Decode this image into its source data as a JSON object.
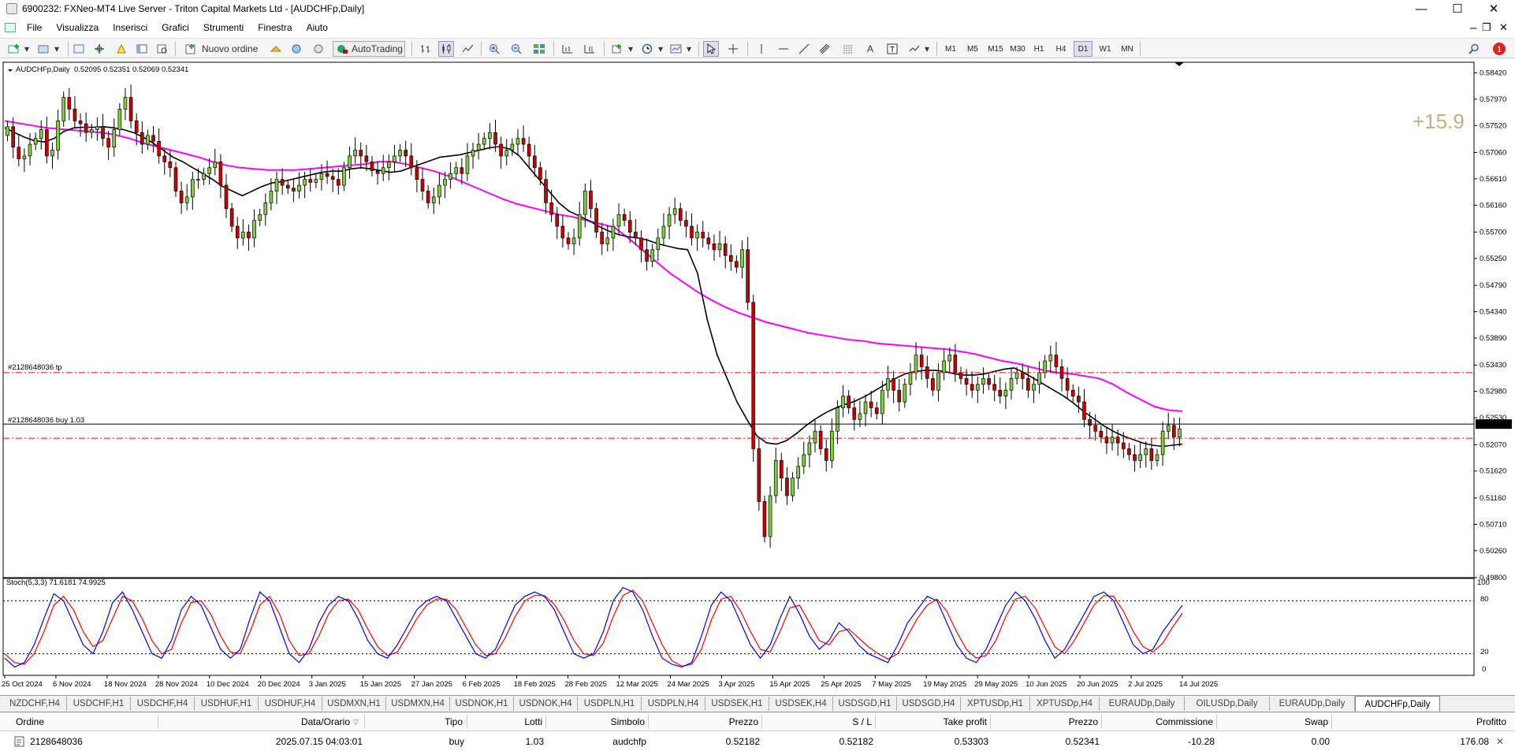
{
  "window": {
    "title": "6900232: FXNeo-MT4 Live Server - Triton Capital Markets Ltd - [AUDCHFp,Daily]",
    "min": "—",
    "max": "☐",
    "close": "✕"
  },
  "menu": [
    "File",
    "Visualizza",
    "Inserisci",
    "Grafici",
    "Strumenti",
    "Finestra",
    "Aiuto"
  ],
  "toolbar": {
    "new_order": "Nuovo ordine",
    "autotrading": "AutoTrading",
    "timeframes": [
      "M1",
      "M5",
      "M15",
      "M30",
      "H1",
      "H4",
      "D1",
      "W1",
      "MN"
    ],
    "active_timeframe": "D1",
    "tool_icons": [
      "cursor-icon",
      "crosshair-icon",
      "vertical-line-icon",
      "horizontal-line-icon",
      "trendline-icon",
      "channel-icon",
      "fibonacci-icon",
      "text-icon",
      "label-icon",
      "shapes-icon"
    ],
    "notification_count": "1"
  },
  "chart": {
    "symbol_label": "AUDCHFp,Daily",
    "ohlc": "0.52095 0.52351 0.52069 0.52341",
    "profit_overlay": "+15.9",
    "tp_line_label": "#2128648036 tp",
    "buy_line_label": "#2128648036 buy 1.03",
    "current_price": "0.52341",
    "price_ticks": [
      "0.58420",
      "0.57970",
      "0.57520",
      "0.57060",
      "0.56610",
      "0.56160",
      "0.55700",
      "0.55250",
      "0.54790",
      "0.54340",
      "0.53890",
      "0.53430",
      "0.52980",
      "0.52530",
      "0.52070",
      "0.51620",
      "0.51160",
      "0.50710",
      "0.50260",
      "0.49800"
    ],
    "date_ticks": [
      "25 Oct 2024",
      "6 Nov 2024",
      "18 Nov 2024",
      "28 Nov 2024",
      "10 Dec 2024",
      "20 Dec 2024",
      "3 Jan 2025",
      "15 Jan 2025",
      "27 Jan 2025",
      "6 Feb 2025",
      "18 Feb 2025",
      "28 Feb 2025",
      "12 Mar 2025",
      "24 Mar 2025",
      "3 Apr 2025",
      "15 Apr 2025",
      "25 Apr 2025",
      "7 May 2025",
      "19 May 2025",
      "29 May 2025",
      "10 Jun 2025",
      "20 Jun 2025",
      "2 Jul 2025",
      "14 Jul 2025"
    ],
    "colors": {
      "bull": "#7cd13a",
      "bear": "#cc0000",
      "ma_fast": "#000000",
      "ma_slow": "#ff00ff",
      "trade_line": "#ff0000",
      "stoch_main": "#0000ff",
      "stoch_signal": "#ff0000"
    },
    "stoch": {
      "label": "Stoch(5,3,3) 71.6181 74.9925",
      "levels": [
        "100",
        "80",
        "20",
        "0"
      ]
    }
  },
  "chart_data": [
    {
      "type": "candlestick",
      "symbol": "AUDCHFp",
      "timeframe": "Daily",
      "ylim": [
        0.498,
        0.586
      ],
      "tp": 0.533,
      "entry": 0.5218,
      "last": 0.52341,
      "close": [
        0.575,
        0.5715,
        0.5695,
        0.57,
        0.572,
        0.573,
        0.5745,
        0.57,
        0.571,
        0.576,
        0.58,
        0.578,
        0.576,
        0.5755,
        0.574,
        0.5745,
        0.575,
        0.573,
        0.5715,
        0.5745,
        0.578,
        0.58,
        0.576,
        0.574,
        0.572,
        0.5735,
        0.5725,
        0.57,
        0.569,
        0.568,
        0.564,
        0.562,
        0.563,
        0.566,
        0.566,
        0.567,
        0.568,
        0.569,
        0.565,
        0.561,
        0.558,
        0.556,
        0.557,
        0.556,
        0.559,
        0.56,
        0.562,
        0.564,
        0.566,
        0.565,
        0.5645,
        0.564,
        0.565,
        0.566,
        0.5655,
        0.566,
        0.567,
        0.5665,
        0.566,
        0.565,
        0.568,
        0.57,
        0.571,
        0.57,
        0.569,
        0.5675,
        0.567,
        0.568,
        0.569,
        0.57,
        0.571,
        0.57,
        0.568,
        0.566,
        0.564,
        0.562,
        0.563,
        0.565,
        0.566,
        0.567,
        0.568,
        0.567,
        0.57,
        0.571,
        0.572,
        0.573,
        0.574,
        0.572,
        0.57,
        0.571,
        0.572,
        0.573,
        0.572,
        0.57,
        0.568,
        0.566,
        0.562,
        0.56,
        0.558,
        0.556,
        0.555,
        0.556,
        0.56,
        0.564,
        0.561,
        0.557,
        0.555,
        0.556,
        0.558,
        0.56,
        0.559,
        0.557,
        0.556,
        0.554,
        0.552,
        0.554,
        0.556,
        0.558,
        0.56,
        0.561,
        0.559,
        0.558,
        0.556,
        0.557,
        0.556,
        0.555,
        0.554,
        0.555,
        0.553,
        0.552,
        0.551,
        0.554,
        0.545,
        0.52,
        0.511,
        0.505,
        0.512,
        0.518,
        0.515,
        0.512,
        0.515,
        0.517,
        0.519,
        0.521,
        0.523,
        0.52,
        0.518,
        0.523,
        0.527,
        0.529,
        0.527,
        0.525,
        0.526,
        0.528,
        0.527,
        0.526,
        0.53,
        0.532,
        0.53,
        0.528,
        0.531,
        0.533,
        0.536,
        0.534,
        0.532,
        0.53,
        0.533,
        0.535,
        0.536,
        0.533,
        0.532,
        0.531,
        0.53,
        0.531,
        0.532,
        0.531,
        0.53,
        0.529,
        0.53,
        0.532,
        0.533,
        0.532,
        0.53,
        0.531,
        0.533,
        0.535,
        0.536,
        0.534,
        0.532,
        0.53,
        0.529,
        0.528,
        0.525,
        0.524,
        0.523,
        0.522,
        0.521,
        0.522,
        0.521,
        0.52,
        0.519,
        0.518,
        0.519,
        0.52,
        0.518,
        0.519,
        0.523,
        0.524,
        0.522,
        0.52341
      ],
      "ma_fast": [
        0.5748,
        0.574,
        0.5732,
        0.5726,
        0.5724,
        0.573,
        0.5742,
        0.5748,
        0.5749,
        0.5749,
        0.575,
        0.5748,
        0.5745,
        0.574,
        0.5732,
        0.5722,
        0.571,
        0.5698,
        0.569,
        0.568,
        0.567,
        0.566,
        0.5648,
        0.564,
        0.5632,
        0.564,
        0.5648,
        0.5654,
        0.5656,
        0.566,
        0.5664,
        0.5668,
        0.5672,
        0.5674,
        0.5674,
        0.5678,
        0.568,
        0.5678,
        0.5675,
        0.5672,
        0.5674,
        0.568,
        0.5686,
        0.5692,
        0.5698,
        0.57,
        0.5702,
        0.5706,
        0.571,
        0.5714,
        0.5716,
        0.5712,
        0.57,
        0.568,
        0.566,
        0.564,
        0.562,
        0.5606,
        0.5598,
        0.559,
        0.558,
        0.5572,
        0.5566,
        0.5562,
        0.556,
        0.5556,
        0.555,
        0.5546,
        0.5542,
        0.554,
        0.55,
        0.542,
        0.536,
        0.532,
        0.528,
        0.525,
        0.5222,
        0.521,
        0.5208,
        0.5214,
        0.5226,
        0.524,
        0.5252,
        0.5262,
        0.527,
        0.5276,
        0.5282,
        0.529,
        0.53,
        0.531,
        0.532,
        0.5328,
        0.5332,
        0.5334,
        0.5334,
        0.5332,
        0.5328,
        0.5326,
        0.5326,
        0.5328,
        0.5332,
        0.5336,
        0.5338,
        0.533,
        0.532,
        0.531,
        0.53,
        0.529,
        0.5278,
        0.5264,
        0.5252,
        0.524,
        0.523,
        0.5222,
        0.5216,
        0.521,
        0.5206,
        0.5204,
        0.5206,
        0.5208
      ],
      "ma_slow": [
        0.576,
        0.5756,
        0.5752,
        0.5748,
        0.5746,
        0.5744,
        0.5742,
        0.574,
        0.5736,
        0.573,
        0.5722,
        0.5716,
        0.571,
        0.5704,
        0.5698,
        0.569,
        0.5684,
        0.568,
        0.5678,
        0.5676,
        0.5676,
        0.5676,
        0.5678,
        0.568,
        0.5682,
        0.5684,
        0.5686,
        0.569,
        0.569,
        0.5686,
        0.568,
        0.5674,
        0.5666,
        0.5656,
        0.5646,
        0.5636,
        0.5626,
        0.5618,
        0.5612,
        0.5606,
        0.56,
        0.5596,
        0.559,
        0.5584,
        0.5578,
        0.556,
        0.554,
        0.552,
        0.55,
        0.5484,
        0.5468,
        0.5454,
        0.5442,
        0.5432,
        0.5424,
        0.5416,
        0.541,
        0.5404,
        0.5398,
        0.5394,
        0.539,
        0.5386,
        0.5384,
        0.538,
        0.5378,
        0.5376,
        0.5374,
        0.5372,
        0.537,
        0.5366,
        0.5362,
        0.5356,
        0.535,
        0.5346,
        0.534,
        0.5334,
        0.533,
        0.5328,
        0.5324,
        0.532,
        0.531,
        0.5296,
        0.5284,
        0.5272,
        0.5266,
        0.5264
      ]
    },
    {
      "type": "line",
      "name": "Stoch(5,3,3)",
      "ylim": [
        0,
        100
      ],
      "levels": [
        20,
        80
      ],
      "main": [
        15,
        5,
        10,
        30,
        60,
        88,
        80,
        55,
        30,
        20,
        45,
        78,
        90,
        70,
        45,
        20,
        15,
        35,
        70,
        85,
        75,
        50,
        25,
        15,
        25,
        60,
        90,
        80,
        50,
        20,
        10,
        25,
        55,
        75,
        85,
        80,
        60,
        35,
        20,
        15,
        30,
        50,
        70,
        80,
        85,
        80,
        60,
        40,
        20,
        15,
        25,
        50,
        75,
        85,
        90,
        85,
        70,
        45,
        20,
        15,
        20,
        45,
        80,
        95,
        90,
        70,
        40,
        15,
        8,
        5,
        10,
        40,
        75,
        90,
        80,
        55,
        30,
        15,
        30,
        60,
        85,
        65,
        40,
        25,
        35,
        55,
        45,
        30,
        20,
        15,
        10,
        30,
        55,
        70,
        85,
        80,
        55,
        30,
        15,
        10,
        25,
        50,
        75,
        90,
        80,
        60,
        35,
        15,
        25,
        45,
        65,
        85,
        90,
        80,
        55,
        30,
        20,
        25,
        45,
        60,
        75
      ],
      "signal": [
        20,
        10,
        8,
        20,
        45,
        75,
        85,
        70,
        45,
        28,
        35,
        60,
        85,
        80,
        60,
        35,
        20,
        25,
        55,
        78,
        80,
        65,
        40,
        22,
        20,
        45,
        75,
        85,
        65,
        35,
        18,
        20,
        40,
        65,
        80,
        82,
        70,
        48,
        28,
        18,
        22,
        40,
        60,
        75,
        82,
        82,
        70,
        50,
        30,
        18,
        20,
        38,
        62,
        80,
        86,
        86,
        76,
        58,
        35,
        20,
        18,
        32,
        62,
        86,
        92,
        80,
        55,
        30,
        12,
        6,
        8,
        25,
        58,
        82,
        85,
        68,
        45,
        25,
        22,
        45,
        72,
        75,
        55,
        35,
        30,
        45,
        48,
        38,
        28,
        20,
        14,
        20,
        40,
        60,
        75,
        82,
        68,
        45,
        25,
        15,
        18,
        35,
        62,
        82,
        85,
        72,
        50,
        28,
        20,
        35,
        55,
        75,
        86,
        85,
        68,
        45,
        28,
        22,
        32,
        50,
        66
      ]
    }
  ],
  "tabs": [
    "NZDCHF,H4",
    "USDCHF,H1",
    "USDCHF,H4",
    "USDHUF,H1",
    "USDHUF,H4",
    "USDMXN,H1",
    "USDMXN,H4",
    "USDNOK,H1",
    "USDNOK,H4",
    "USDPLN,H1",
    "USDPLN,H4",
    "USDSEK,H1",
    "USDSEK,H4",
    "USDSGD,H1",
    "USDSGD,H4",
    "XPTUSDp,H1",
    "XPTUSDp,H4",
    "EURAUDp,Daily",
    "OILUSDp,Daily",
    "EURAUDp,Daily",
    "AUDCHFp,Daily"
  ],
  "active_tab": "AUDCHFp,Daily",
  "terminal": {
    "headers": [
      "Ordine",
      "Data/Orario",
      "Tipo",
      "Lotti",
      "Simbolo",
      "Prezzo",
      "S / L",
      "Take profit",
      "Prezzo",
      "Commissione",
      "Swap",
      "Profitto"
    ],
    "row": [
      "2128648036",
      "2025.07.15 04:03:01",
      "buy",
      "1.03",
      "audchfp",
      "0.52182",
      "0.52182",
      "0.53303",
      "0.52341",
      "-10.28",
      "0.00",
      "176.08"
    ],
    "close_x": "✕"
  }
}
